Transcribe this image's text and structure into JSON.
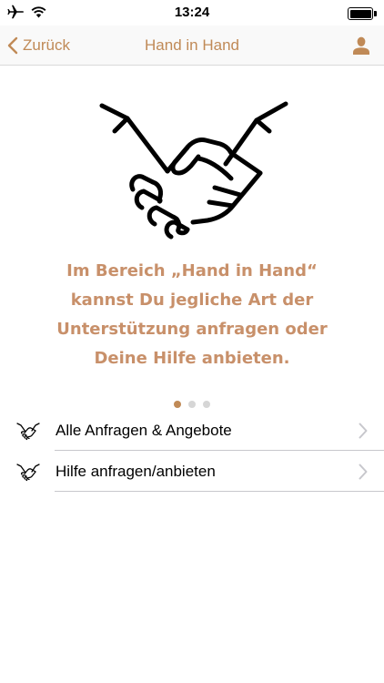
{
  "status_bar": {
    "time": "13:24",
    "icons": [
      "airplane-icon",
      "wifi-icon",
      "battery-icon"
    ]
  },
  "nav": {
    "back_label": "Zurück",
    "title": "Hand in Hand",
    "right_icon": "profile-icon"
  },
  "hero": {
    "icon": "handshake-icon",
    "text_lines": [
      "Im Bereich „Hand in Hand“",
      "kannst Du jegliche Art der",
      "Unterstützung anfragen oder",
      "Deine Hilfe anbieten."
    ]
  },
  "pager": {
    "total": 3,
    "current": 1
  },
  "menu": {
    "items": [
      {
        "label": "Alle Anfragen & Angebote",
        "icon": "handshake-icon"
      },
      {
        "label": "Hilfe anfragen/anbieten",
        "icon": "handshake-icon"
      }
    ]
  },
  "colors": {
    "accent": "#c08a57",
    "text_accent": "#c8906a",
    "separator": "#c8c8cc"
  }
}
